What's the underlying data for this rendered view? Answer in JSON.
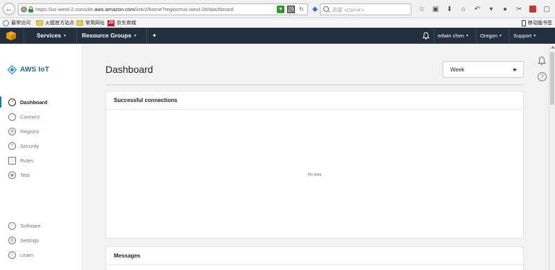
{
  "browser": {
    "url_prefix": "https://us-west-2.console.",
    "url_domain": "aws.amazon.com",
    "url_path": "/iotv2/home?region=us-west-2#/dashboard",
    "search_placeholder": "百度 <Ctrl+K>"
  },
  "bookmarks": {
    "items": [
      "最常访问",
      "火狐官方站点",
      "常用网址",
      "京东商城"
    ],
    "jd_badge": "JD",
    "mobile_bookmarks": "移动版书签"
  },
  "aws_header": {
    "services": "Services",
    "resource_groups": "Resource Groups",
    "user": "edwin chen",
    "region": "Oregon",
    "support": "Support",
    "caret": "▾",
    "pin": "✦"
  },
  "sidebar": {
    "brand": "AWS IoT",
    "items": [
      {
        "label": "Dashboard"
      },
      {
        "label": "Connect"
      },
      {
        "label": "Registry"
      },
      {
        "label": "Security"
      },
      {
        "label": "Rules"
      },
      {
        "label": "Test"
      }
    ],
    "bottom_items": [
      {
        "label": "Software"
      },
      {
        "label": "Settings"
      },
      {
        "label": "Learn"
      }
    ]
  },
  "main": {
    "title": "Dashboard",
    "period_select": "Week",
    "panels": [
      {
        "title": "Successful connections",
        "empty_text": "No data"
      },
      {
        "title": "Messages"
      }
    ]
  },
  "util": {
    "help": "?"
  },
  "colors": {
    "aws_header_bg": "#232f3e",
    "accent": "#0a7aa9",
    "content_bg": "#f2f2f2"
  }
}
